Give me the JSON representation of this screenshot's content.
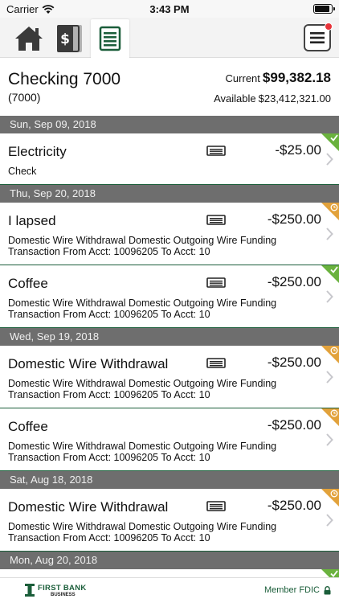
{
  "status_bar": {
    "carrier": "Carrier",
    "time": "3:43 PM",
    "battery_level": 0.95
  },
  "toolbar": {
    "tabs": [
      {
        "icon": "home-icon",
        "active": false
      },
      {
        "icon": "checks-icon",
        "active": false
      },
      {
        "icon": "transactions-icon",
        "active": true
      }
    ],
    "menu_icon": "hamburger-menu-icon",
    "notification_badge": true
  },
  "account": {
    "title": "Checking 7000",
    "number": "(7000)",
    "current_label": "Current",
    "current_amount": "$99,382.18",
    "available_label": "Available",
    "available_amount": "$23,412,321.00"
  },
  "groups": [
    {
      "date": "Sun, Sep 09, 2018",
      "transactions": [
        {
          "title": "Electricity",
          "desc1": "Check",
          "desc2": "",
          "amount": "-$25.00",
          "status": "cleared"
        }
      ]
    },
    {
      "date": "Thu, Sep 20, 2018",
      "transactions": [
        {
          "title": "I lapsed",
          "desc1": "Domestic Wire Withdrawal  Domestic Outgoing Wire Funding",
          "desc2": "Transaction From Acct: 10096205 To Acct: 10",
          "amount": "-$250.00",
          "status": "pending"
        },
        {
          "title": "Coffee",
          "desc1": "Domestic Wire Withdrawal  Domestic Outgoing Wire Funding",
          "desc2": "Transaction From Acct: 10096205 To Acct: 10",
          "amount": "-$250.00",
          "status": "cleared"
        }
      ]
    },
    {
      "date": "Wed, Sep 19, 2018",
      "transactions": [
        {
          "title": "Domestic Wire Withdrawal",
          "desc1": "Domestic Wire Withdrawal  Domestic Outgoing Wire Funding",
          "desc2": "Transaction From Acct: 10096205 To Acct: 10",
          "amount": "-$250.00",
          "status": "pending"
        },
        {
          "title": "Coffee",
          "desc1": "Domestic Wire Withdrawal  Domestic Outgoing Wire Funding",
          "desc2": "Transaction From Acct: 10096205 To Acct: 10",
          "amount": "-$250.00",
          "status": "pending"
        }
      ]
    },
    {
      "date": "Sat, Aug 18, 2018",
      "transactions": [
        {
          "title": "Domestic Wire Withdrawal",
          "desc1": "Domestic Wire Withdrawal  Domestic Outgoing Wire Funding",
          "desc2": "Transaction From Acct: 10096205 To Acct: 10",
          "amount": "-$250.00",
          "status": "pending"
        }
      ]
    },
    {
      "date": "Mon, Aug 20, 2018",
      "transactions": []
    }
  ],
  "footer": {
    "bank_name": "FIRST BANK",
    "bank_sub": "BUSINESS",
    "fdic": "Member FDIC"
  },
  "colors": {
    "brand_green": "#1b5e3a",
    "cleared": "#6ab23e",
    "pending": "#e2a23b",
    "date_header": "#6e6e6e"
  }
}
